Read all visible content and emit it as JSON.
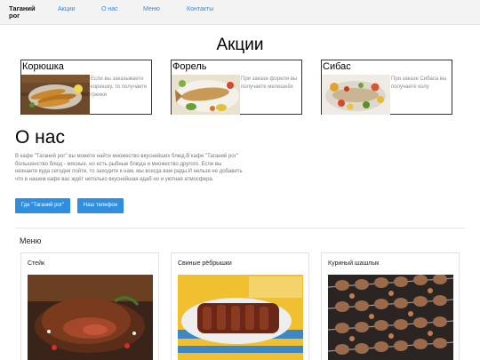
{
  "nav": {
    "brand": "Таганий рог",
    "links": [
      "Акции",
      "О нас",
      "Меню",
      "Контакты"
    ]
  },
  "promos": {
    "title": "Акции",
    "cards": [
      {
        "name": "Корюшка",
        "text": "Если вы заказываете корюшку, то получаете гренки"
      },
      {
        "name": "Форель",
        "text": "При заказе форели вы получаете мелешейх"
      },
      {
        "name": "Сибас",
        "text": "При заказе Сибаса вы получаете колу"
      }
    ]
  },
  "about": {
    "title": "О нас",
    "text": "В кафе \"Таганий рог\" вы можете найти множество вкуснейших блюд.В кафе \"Таганий рог\" большенство блюд - мясные, но есть рыбные блюда и множество другого. Если вы незнаете куда сегодня пойти, то заходите к нам, мы всегда вам рады.И нельзя не добавить что в нашем кафе вас ждёт нетолько вкуснейшая едаб но и уютная атмосфера.",
    "buttons": [
      "Где \"Таганий рог\"",
      "Наш телефон"
    ]
  },
  "menu": {
    "heading": "Меню",
    "items": [
      {
        "name": "Стейк",
        "icon": "steak-photo"
      },
      {
        "name": "Свиные рёбрышки",
        "icon": "ribs-photo"
      },
      {
        "name": "Куриный шашлык",
        "icon": "kebab-photo"
      }
    ]
  },
  "colors": {
    "accent": "#2e8fe0",
    "nav_background": "#f3f3f3",
    "muted_text": "#8a8a8a"
  }
}
